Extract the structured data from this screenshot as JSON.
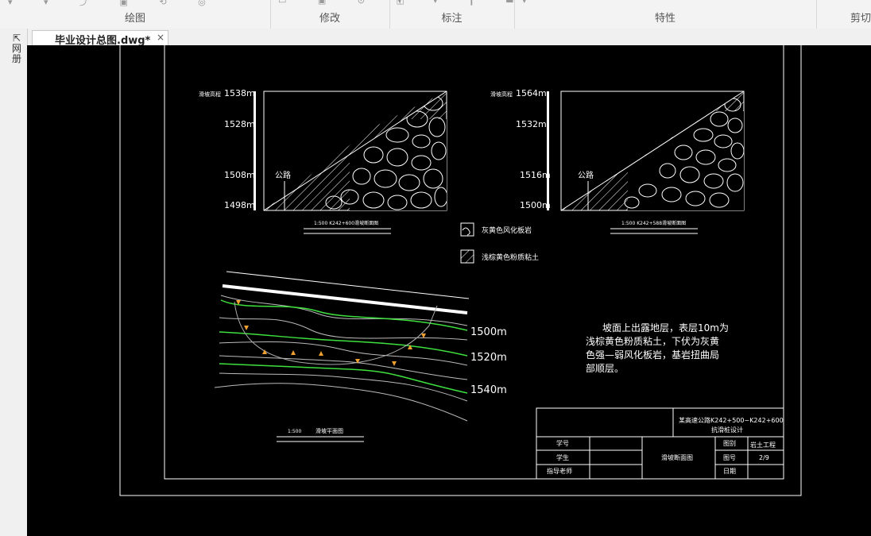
{
  "ribbon": {
    "groups": [
      "绘图",
      "修改",
      "标注",
      "特性",
      "剪切"
    ]
  },
  "tabs": {
    "active_title": "毕业设计总图.dwg*",
    "close_glyph": "×"
  },
  "left_tool": {
    "glyph": "网\n册"
  },
  "drawing": {
    "section1": {
      "label": "滑坡高程",
      "elev_top": "1538m",
      "elev_2": "1528m",
      "elev_3": "1508m",
      "elev_bottom": "1498m",
      "road": "公路",
      "caption": "1:500 K242+600滑坡断面图"
    },
    "section2": {
      "label": "滑坡高程",
      "elev_top": "1564m",
      "elev_2": "1532m",
      "elev_3": "1516m",
      "elev_bottom": "1500m",
      "road": "公路",
      "caption": "1:500 K242+588滑坡断面图"
    },
    "legend": {
      "item1": "灰黄色风化板岩",
      "item2": "浅棕黄色粉质粘土"
    },
    "plan": {
      "contour1": "1500m",
      "contour2": "1520m",
      "contour3": "1540m",
      "caption_scale": "1:500",
      "caption_title": "滑坡平面图"
    },
    "notes": {
      "line1": "坡面上出露地层，表层10m为",
      "line2": "浅棕黄色粉质粘土，下伏为灰黄",
      "line3": "色强—弱风化板岩，基岩扭曲局",
      "line4": "部顺层。"
    },
    "title_block": {
      "project_line1": "某高速公路K242+500~K242+600",
      "project_line2": "抗滑桩设计",
      "student_id_label": "学号",
      "student_label": "学生",
      "advisor_label": "指导老师",
      "drawing_name": "滑坡断面图",
      "category_label": "图别",
      "category_value": "岩土工程",
      "number_label": "图号",
      "number_value": "2/9",
      "date_label": "日期"
    }
  }
}
